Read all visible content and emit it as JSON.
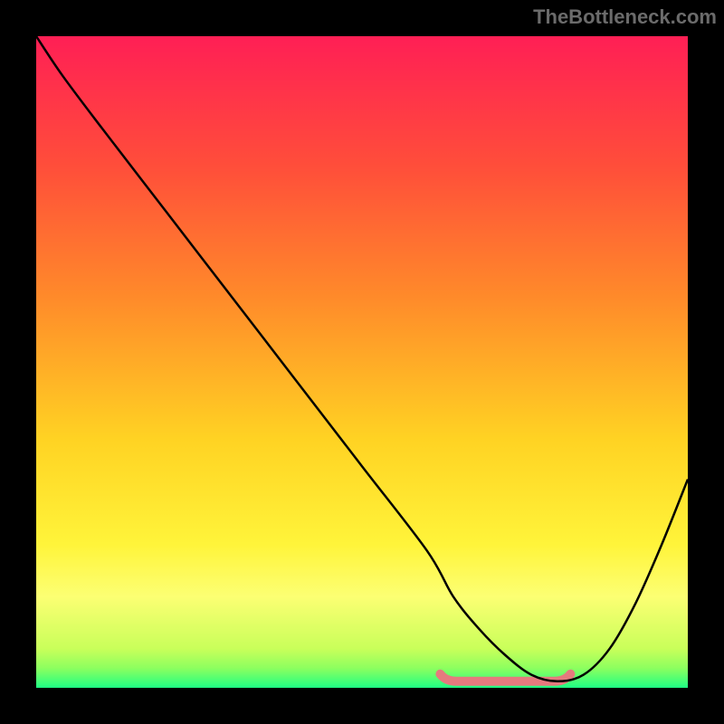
{
  "watermark": "TheBottleneck.com",
  "chart_data": {
    "type": "line",
    "title": "",
    "xlabel": "",
    "ylabel": "",
    "xlim": [
      0,
      100
    ],
    "ylim": [
      0,
      100
    ],
    "background_gradient_stops": [
      {
        "offset": 0.0,
        "color": "#ff1f55"
      },
      {
        "offset": 0.2,
        "color": "#ff4e3a"
      },
      {
        "offset": 0.4,
        "color": "#ff8a2a"
      },
      {
        "offset": 0.62,
        "color": "#ffd323"
      },
      {
        "offset": 0.78,
        "color": "#fff43a"
      },
      {
        "offset": 0.86,
        "color": "#fcff73"
      },
      {
        "offset": 0.94,
        "color": "#c9ff5a"
      },
      {
        "offset": 0.97,
        "color": "#8cff5f"
      },
      {
        "offset": 1.0,
        "color": "#1fff84"
      }
    ],
    "series": [
      {
        "name": "bottleneck-curve",
        "color": "#000000",
        "x": [
          0,
          4,
          10,
          20,
          30,
          40,
          50,
          60,
          64,
          68,
          72,
          76,
          80,
          84,
          88,
          92,
          96,
          100
        ],
        "y": [
          100,
          94,
          86,
          73,
          60,
          47,
          34,
          21,
          14,
          9,
          5,
          2,
          1,
          2,
          6,
          13,
          22,
          32
        ]
      }
    ],
    "optimal_band": {
      "color": "#e57a7e",
      "x_start": 62,
      "x_end": 82,
      "y": 1
    }
  }
}
